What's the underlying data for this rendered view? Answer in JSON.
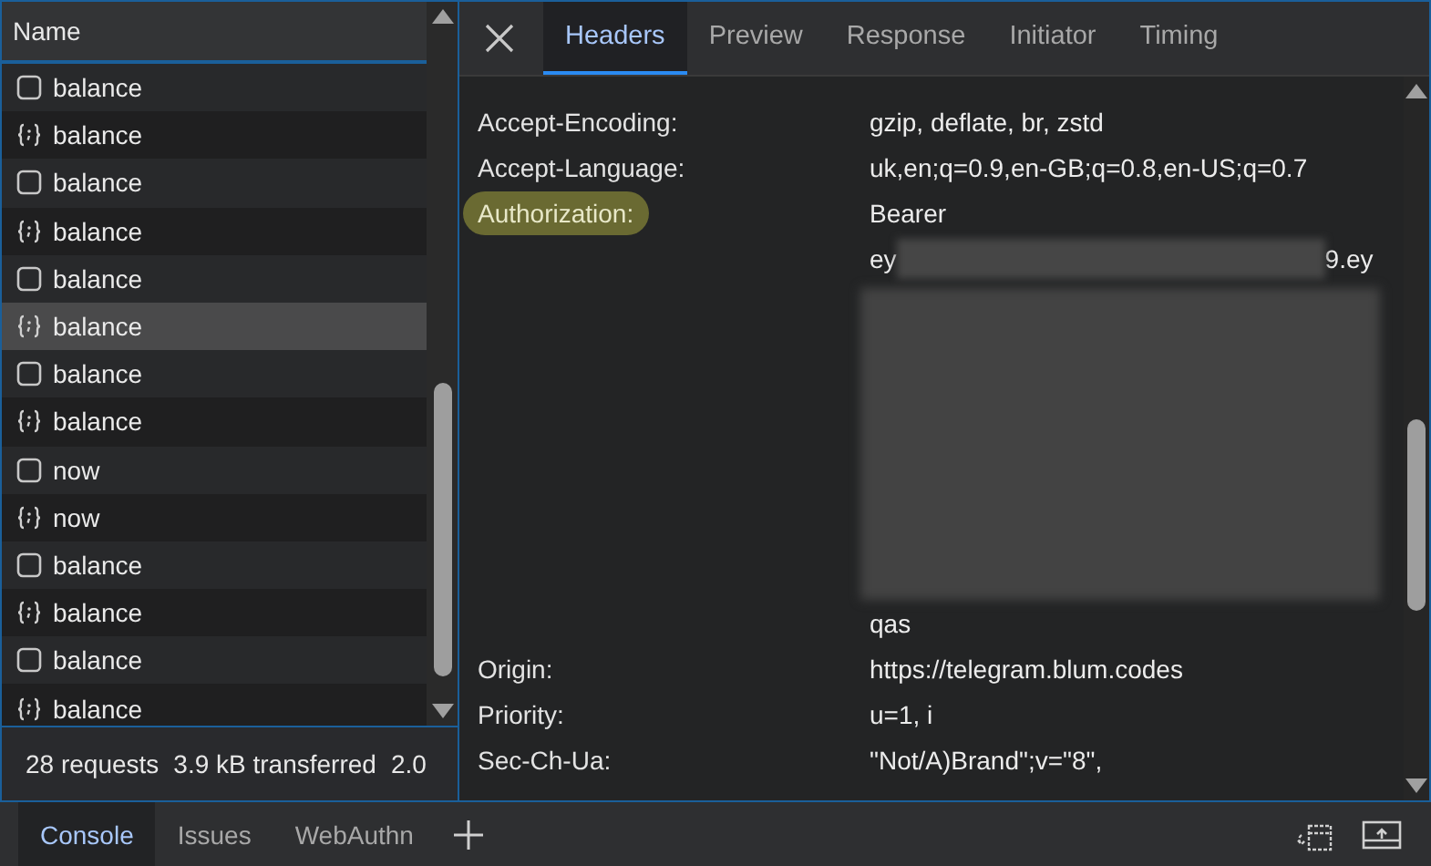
{
  "requests": {
    "column": "Name",
    "rows": [
      {
        "name": "balance",
        "kind": "doc",
        "selected": false
      },
      {
        "name": "balance",
        "kind": "fetch",
        "selected": false
      },
      {
        "name": "balance",
        "kind": "doc",
        "selected": false
      },
      {
        "name": "balance",
        "kind": "fetch",
        "selected": false
      },
      {
        "name": "balance",
        "kind": "doc",
        "selected": false
      },
      {
        "name": "balance",
        "kind": "fetch",
        "selected": true
      },
      {
        "name": "balance",
        "kind": "doc",
        "selected": false
      },
      {
        "name": "balance",
        "kind": "fetch",
        "selected": false
      },
      {
        "name": "now",
        "kind": "doc",
        "selected": false
      },
      {
        "name": "now",
        "kind": "fetch",
        "selected": false
      },
      {
        "name": "balance",
        "kind": "doc",
        "selected": false
      },
      {
        "name": "balance",
        "kind": "fetch",
        "selected": false
      },
      {
        "name": "balance",
        "kind": "doc",
        "selected": false
      },
      {
        "name": "balance",
        "kind": "fetch",
        "selected": false
      }
    ],
    "summary": [
      "28 requests",
      "3.9 kB transferred",
      "2.0"
    ]
  },
  "details": {
    "tabs": [
      {
        "label": "Headers",
        "selected": true
      },
      {
        "label": "Preview",
        "selected": false
      },
      {
        "label": "Response",
        "selected": false
      },
      {
        "label": "Initiator",
        "selected": false
      },
      {
        "label": "Timing",
        "selected": false
      }
    ],
    "headers": [
      {
        "kind": "header",
        "name": "Accept-Encoding:",
        "value": "gzip, deflate, br, zstd",
        "highlighted": false
      },
      {
        "kind": "header",
        "name": "Accept-Language:",
        "value": "uk,en;q=0.9,en-GB;q=0.8,en-US;q=0.7",
        "highlighted": false
      },
      {
        "kind": "header",
        "name": "Authorization:",
        "value": "Bearer",
        "highlighted": true
      },
      {
        "kind": "token",
        "start": "ey",
        "end": "9.ey"
      },
      {
        "kind": "redacted"
      },
      {
        "kind": "continuation",
        "value": "qas"
      },
      {
        "kind": "header",
        "name": "Origin:",
        "value": "https://telegram.blum.codes",
        "highlighted": false
      },
      {
        "kind": "header",
        "name": "Priority:",
        "value": "u=1, i",
        "highlighted": false
      },
      {
        "kind": "header",
        "name": "Sec-Ch-Ua:",
        "value": "\"Not/A)Brand\";v=\"8\",",
        "highlighted": false
      }
    ]
  },
  "drawer": {
    "tabs": [
      {
        "label": "Console",
        "selected": true
      },
      {
        "label": "Issues",
        "selected": false
      },
      {
        "label": "WebAuthn",
        "selected": false
      }
    ]
  }
}
